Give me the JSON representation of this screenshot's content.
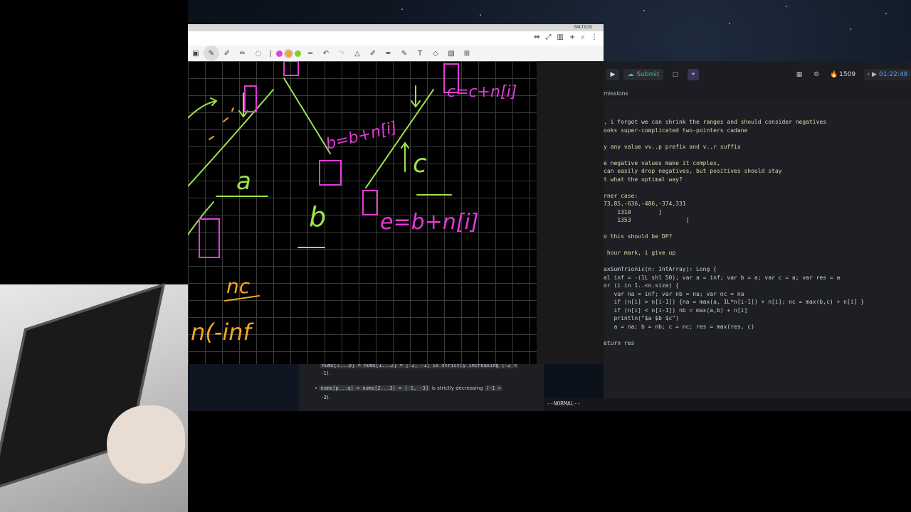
{
  "drawing_app": {
    "device_label": "SM-T970",
    "toolbar_icons": [
      "select-icon",
      "lasso-icon",
      "pen-icon",
      "highlighter-icon",
      "eraser-icon",
      "shape-icon",
      "undo-icon",
      "redo-icon",
      "ruler-icon",
      "text-icon",
      "image-icon",
      "more-icon"
    ],
    "pen_colors": [
      "#e040e0",
      "#f5a623",
      "#7ed321"
    ],
    "handwriting": {
      "a_label": "a",
      "b_label": "b",
      "c_label": "c",
      "nc_label": "nc",
      "b_formula": "b=b+n[i]",
      "c_formula": "c=c+n[i]",
      "e_formula": "e=b+n[i]",
      "inf_text": "n(-inf"
    }
  },
  "editor": {
    "buttons": {
      "run": "▶",
      "submit": "Submit"
    },
    "streak": "1509",
    "timer": "01:22:48",
    "subtab": "missions",
    "code_lines": [
      ", i forgot we can shrink the ranges and should consider negatives",
      "ooks super-complicated two-pointers cadane",
      "",
      "y any value vv..p prefix and v..r suffix",
      "",
      "e negative values make it complex,",
      "can easily drop negatives, but positives should stay",
      "t what the optimal way?",
      "",
      "rner case:",
      "73,85,-636,-486,-374,331",
      "    1310        ]",
      "    1353                ]",
      "",
      "o this should be DP?",
      "",
      " hour mark, i give up",
      "",
      "axSumTrionic(n: IntArray): Long {",
      "al inf = -(1L shl 50); var a = inf; var b = a; var c = a; var res = a",
      "or (i in 1..<n.size) {",
      "   var na = inf; var nb = na; var nc = na",
      "   if (n[i] > n[i-1]) {na = max(a, 1L*n[i-1]) + n[i]; nc = max(b,c) + n[i] }",
      "   if (n[i] < n[i-1]) nb = max(a,b) + n[i]",
      "   println(\"$a $b $c\")",
      "   a = na; b = nb; c = nc; res = max(res, c)",
      "",
      "eturn res"
    ],
    "mode": "--NORMAL--"
  },
  "description": {
    "line1": "nums[l...p] = nums[1...2] = [-2, -1] is strictly increasing (-2 <",
    "line1b": "-1).",
    "bullet2_code": "nums[p...q] = nums[2...3] = [-1, -3]",
    "bullet2_text": " is strictly decreasing ",
    "bullet2_chip": "(-1 >",
    "bullet2_tail": "-3)."
  }
}
